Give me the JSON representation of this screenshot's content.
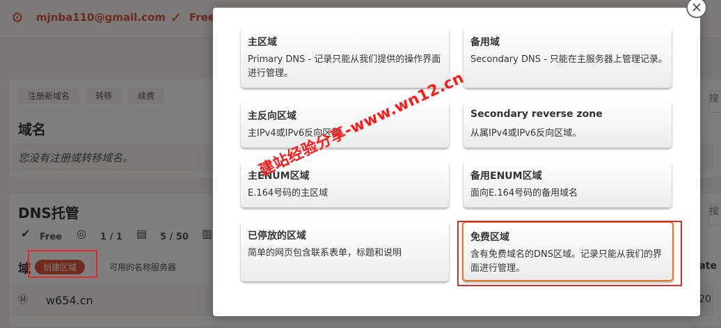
{
  "topbar": {
    "email": "mjnba110@gmail.com",
    "plan_label": "Free"
  },
  "domains_card": {
    "tabs": [
      "注册新域名",
      "转移",
      "续费"
    ],
    "heading": "域名",
    "empty_text": "您没有注册或转移域名。"
  },
  "dns_card": {
    "heading": "DNS托管",
    "stats": [
      {
        "icon": "badge-icon",
        "value": "Free"
      },
      {
        "icon": "satellite-icon",
        "value": "1 / 1"
      },
      {
        "icon": "server-icon",
        "value": "5 / 50"
      },
      {
        "icon": "bar-chart-icon",
        "value": ""
      }
    ],
    "create_zone_label": "创建区域",
    "nameservers_label": "可用的名称服务器",
    "domain_row_prefix": "域",
    "domain": "w654.cn",
    "right_partial_date": "ate",
    "right_partial_num": "-20",
    "side_char": "搜"
  },
  "modal": {
    "close_label": "×",
    "options": [
      {
        "title": "主区域",
        "desc": "Primary DNS - 记录只能从我们提供的操作界面进行管理。",
        "active": false
      },
      {
        "title": "备用域",
        "desc": "Secondary DNS - 只能在主服务器上管理记录。",
        "active": false
      },
      {
        "title": "主反向区域",
        "desc": "主IPv4或IPv6反向区域。",
        "active": false
      },
      {
        "title": "Secondary reverse zone",
        "desc": "从属IPv4或IPv6反向区域。",
        "active": false
      },
      {
        "title": "主ENUM区域",
        "desc": "E.164号码的主区域",
        "active": false
      },
      {
        "title": "备用ENUM区域",
        "desc": "面向E.164号码的备用域名",
        "active": false
      },
      {
        "title": "已停放的区域",
        "desc": "简单的网页包含联系表单，标题和说明",
        "active": false
      },
      {
        "title": "免费区域",
        "desc": "含有免费域名的DNS区域。记录只能从我们的界面进行管理。",
        "active": true
      }
    ]
  },
  "watermark": "建站经验分享-www.wn12.cn",
  "colors": {
    "accent": "#e05638",
    "highlight_box": "#e02a2a",
    "active_border": "#e8772c",
    "watermark": "#ff1a1a"
  }
}
